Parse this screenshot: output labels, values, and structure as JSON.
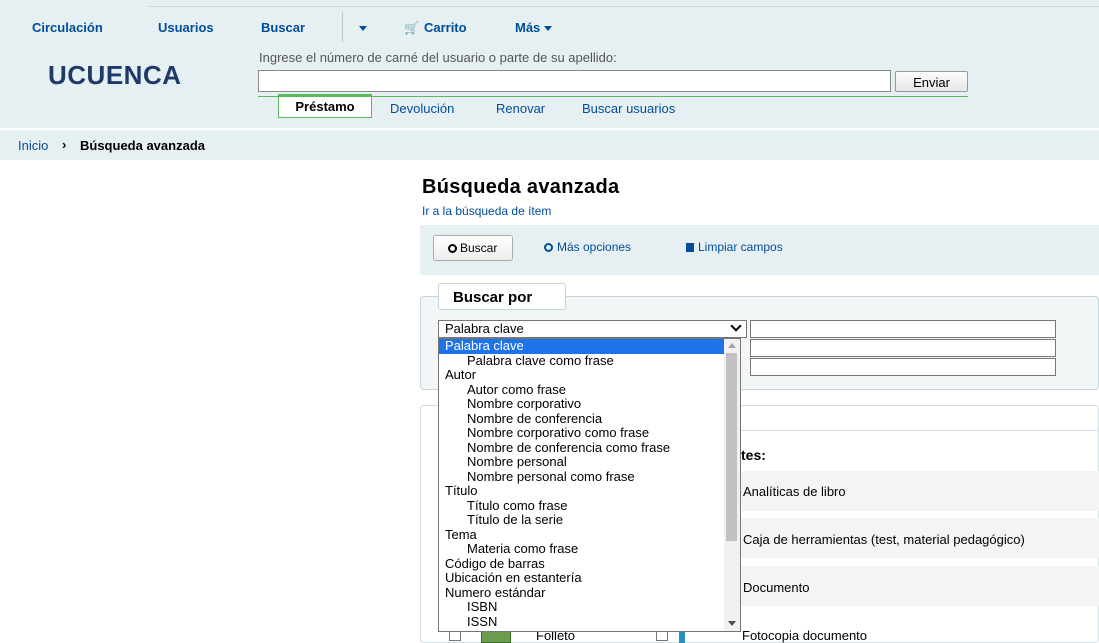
{
  "nav": {
    "circulacion": "Circulación",
    "usuarios": "Usuarios",
    "buscar": "Buscar",
    "carrito": "Carrito",
    "mas": "Más"
  },
  "logo": "UCUENCA",
  "checkout": {
    "prompt": "Ingrese el número de carné del usuario o parte de su apellido:",
    "input_value": "",
    "send_label": "Enviar",
    "tabs": [
      "Préstamo",
      "Devolución",
      "Renovar",
      "Buscar usuarios"
    ]
  },
  "breadcrumb": {
    "home": "Inicio",
    "separator": "›",
    "current": "Búsqueda avanzada"
  },
  "page": {
    "title": "Búsqueda avanzada",
    "item_search_link": "Ir a la búsqueda de ítem"
  },
  "toolbar": {
    "search_label": "Buscar",
    "more_options": "Más opciones",
    "clear_fields": "Limpiar campos"
  },
  "search_by": {
    "legend": "Buscar por",
    "selected": "Palabra clave"
  },
  "dropdown_options": [
    {
      "label": "Palabra clave",
      "indent": false,
      "selected": true
    },
    {
      "label": "Palabra clave como frase",
      "indent": true
    },
    {
      "label": "Autor",
      "indent": false
    },
    {
      "label": "Autor como frase",
      "indent": true
    },
    {
      "label": "Nombre corporativo",
      "indent": true
    },
    {
      "label": "Nombre de conferencia",
      "indent": true
    },
    {
      "label": "Nombre corporativo como frase",
      "indent": true
    },
    {
      "label": "Nombre de conferencia como frase",
      "indent": true
    },
    {
      "label": "Nombre personal",
      "indent": true
    },
    {
      "label": "Nombre personal como frase",
      "indent": true
    },
    {
      "label": "Título",
      "indent": false
    },
    {
      "label": "Título como frase",
      "indent": true
    },
    {
      "label": "Título de la serie",
      "indent": true
    },
    {
      "label": "Tema",
      "indent": false
    },
    {
      "label": "Materia como frase",
      "indent": true
    },
    {
      "label": "Código de barras",
      "indent": false
    },
    {
      "label": "Ubicación en estantería",
      "indent": false
    },
    {
      "label": "Numero estándar",
      "indent": false
    },
    {
      "label": "ISBN",
      "indent": true
    },
    {
      "label": "ISSN",
      "indent": true
    }
  ],
  "item_types": {
    "heading_fragment": "tes:",
    "options": [
      "Analíticas de libro",
      "Caja de herramientas (test, material pedagógico)",
      "Documento",
      "Folleto",
      "Fotocopia documento"
    ]
  },
  "colors": {
    "link": "#004d99",
    "header_bg": "#e6f0f2",
    "tab_accent": "#5cb85c",
    "selected": "#1e73e8"
  }
}
